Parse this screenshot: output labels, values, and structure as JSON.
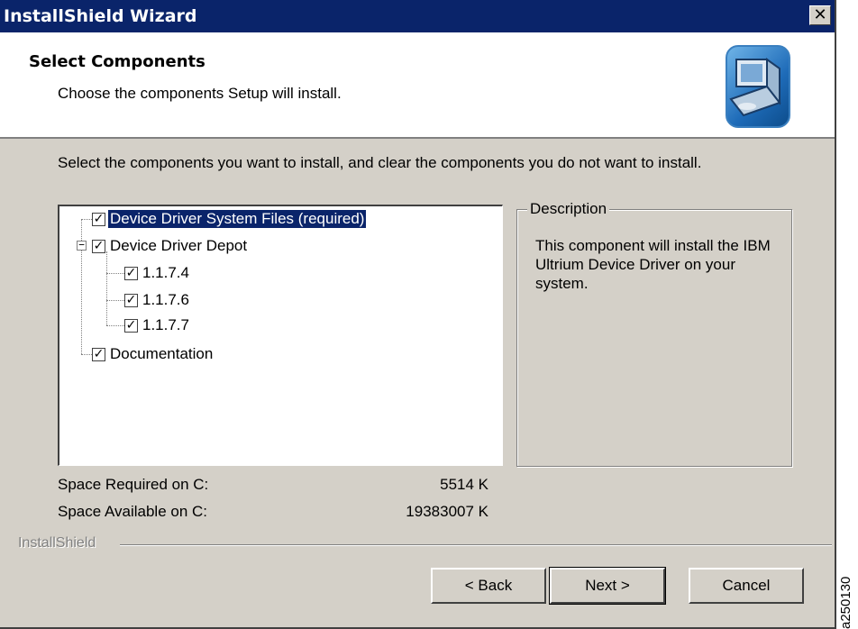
{
  "window": {
    "title": "InstallShield Wizard",
    "close_label": "✕"
  },
  "header": {
    "title": "Select Components",
    "subtitle": "Choose the components Setup will install."
  },
  "intro": "Select the components you want to install, and clear the components you do not want to install.",
  "tree": [
    {
      "label": "Device Driver System Files (required)",
      "checked": true,
      "level": 0,
      "selected": true
    },
    {
      "label": "Device Driver Depot",
      "checked": true,
      "level": 0,
      "expanded": true
    },
    {
      "label": "1.1.7.4",
      "checked": true,
      "level": 1
    },
    {
      "label": "1.1.7.6",
      "checked": true,
      "level": 1
    },
    {
      "label": "1.1.7.7",
      "checked": true,
      "level": 1
    },
    {
      "label": "Documentation",
      "checked": true,
      "level": 0
    }
  ],
  "description": {
    "legend": "Description",
    "text": "This component will install the IBM Ultrium Device Driver on your system."
  },
  "space": {
    "required_label": "Space Required on  C:",
    "required_value": "5514 K",
    "available_label": "Space Available on  C:",
    "available_value": "19383007 K"
  },
  "brand": "InstallShield",
  "buttons": {
    "back": "< Back",
    "next": "Next >",
    "cancel": "Cancel"
  },
  "side_label": "a250130",
  "colors": {
    "title_bar": "#0a246a",
    "dialog": "#d4d0c8",
    "selection": "#0a246a"
  }
}
